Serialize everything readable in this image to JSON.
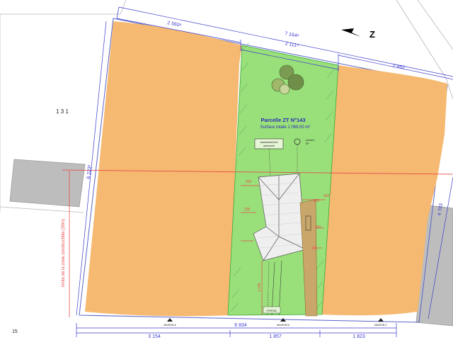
{
  "north": {
    "label": "Z",
    "icon": "north-arrow-icon"
  },
  "parcel": {
    "title": "Parcelle ZT N°143",
    "surface": "Surface totale 1 068,00 m²",
    "color": "#99e07a"
  },
  "neighbor_parcel_label": "1 3 1",
  "sheet_number": "15",
  "colors": {
    "unbuildable_zone": "#f5b971",
    "dimension_lines": "#3b3bd0",
    "limit_line": "#e84b4b",
    "house_roof": "#efefef",
    "neighbor_buildings": "#bdbdbd"
  },
  "top_dimensions": {
    "left_segment": "2 560⁶",
    "total": "7 164⁸",
    "middle_segment": "2 111⁵",
    "right_segment": "2 462"
  },
  "side_dimensions": {
    "left": "6 223³",
    "right": "4 783"
  },
  "bottom_dimensions": {
    "total": "6 834",
    "segment_a": "3 154",
    "segment_b": "1 857",
    "segment_c": "1 823"
  },
  "vertical_labels": {
    "zone_limit": "limite de la zone constructible (30m)",
    "access": "1 145"
  },
  "house_dimensions": {
    "a": "335",
    "b": "355",
    "c": "350",
    "d": "350",
    "e": "195",
    "f": "235"
  },
  "annotations": {
    "sanitation_1": "assainissement",
    "sanitation_2": "autonome",
    "point_1": "puisard",
    "point_2": "EP",
    "gate": "PORTAIL"
  },
  "houses": {
    "a": "MAISON A",
    "b": "MAISON B",
    "c": "MAISON C"
  }
}
